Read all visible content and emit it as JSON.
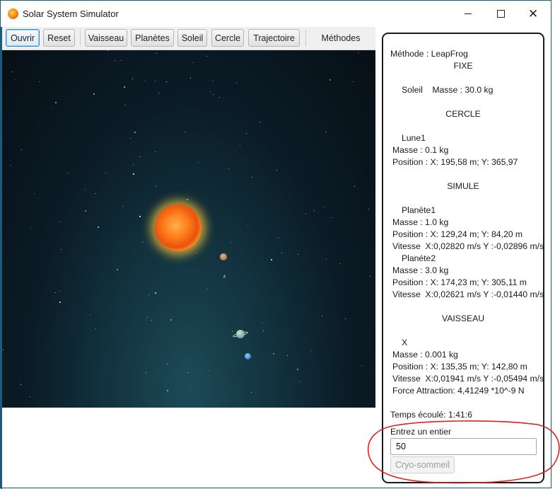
{
  "window": {
    "title": "Solar System Simulator",
    "minimize": "—",
    "maximize": "☐",
    "close": "✕"
  },
  "toolbar": {
    "ouvrir": "Ouvrir",
    "reset": "Reset",
    "vaisseau": "Vaisseau",
    "planetes": "Planètes",
    "soleil": "Soleil",
    "cercle": "Cercle",
    "trajectoire": "Trajectoire",
    "methodes": "Méthodes"
  },
  "info": {
    "methode": "Méthode : LeapFrog",
    "fixe_header": "FIXE",
    "soleil_line": "Soleil    Masse : 30.0 kg",
    "cercle_header": "CERCLE",
    "lune_name": "Lune1",
    "lune_masse": "Masse : 0.1 kg",
    "lune_position": "Position : X: 195,58 m; Y: 365,97",
    "simule_header": "SIMULE",
    "p1_name": "Planète1",
    "p1_masse": "Masse : 1.0 kg",
    "p1_position": "Position : X: 129,24 m; Y: 84,20 m",
    "p1_vitesse": "Vitesse  X:0,02820 m/s Y :-0,02896 m/s",
    "p2_name": "Planéte2",
    "p2_masse": "Masse : 3.0 kg",
    "p2_position": "Position : X: 174,23 m; Y: 305,11 m",
    "p2_vitesse": "Vitesse  X:0,02621 m/s Y :-0,01440 m/s",
    "vaisseau_header": "VAISSEAU",
    "v_name": "X",
    "v_masse": "Masse : 0.001 kg",
    "v_position": "Position : X: 135,35 m; Y: 142,80 m",
    "v_vitesse": "Vitesse  X:0,01941 m/s Y :-0,05494 m/s",
    "v_force": "Force Attraction: 4,41249 *10^-9 N",
    "temps": "Temps écoulé: 1:41:6"
  },
  "cryo": {
    "prompt": "Entrez un entier",
    "value": "50",
    "button": "Cryo-sommeil"
  },
  "colors": {
    "titlebar_accent": "#1c5a7a",
    "annotation": "#e0231f",
    "focus": "#3b8fd1"
  },
  "icons": {
    "app": "sun-icon",
    "ship": "ship-icon"
  }
}
